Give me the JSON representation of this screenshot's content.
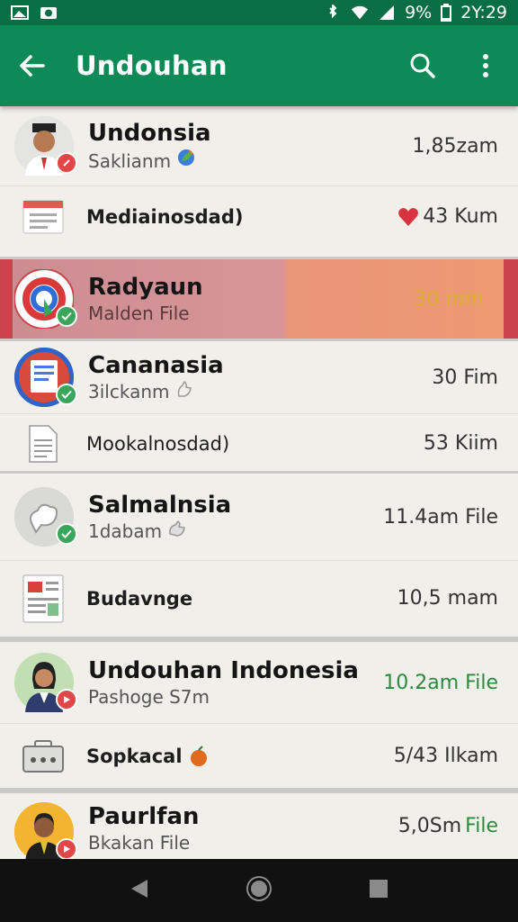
{
  "status_bar": {
    "battery": "9%",
    "time": "2Y:29"
  },
  "app_bar": {
    "title": "Undouhan"
  },
  "groups": [
    {
      "main": {
        "name": "Undonsia",
        "sub": "Saklianm",
        "meta": "1,85zam"
      },
      "sub": {
        "label": "Mediainosdad)",
        "meta": "43 Kum"
      }
    },
    {
      "main": {
        "name": "Radyaun",
        "sub": "Malden File",
        "meta": "30 mm"
      }
    },
    {
      "main": {
        "name": "Cananasia",
        "sub": "3ilckanm",
        "meta": "30 Fim"
      },
      "sub": {
        "label": "Mookalnosdad)",
        "meta": "53 Kiim"
      }
    },
    {
      "main": {
        "name": "Salmalnsia",
        "sub": "1dabam",
        "meta": "11.4am File"
      },
      "sub": {
        "label": "Budavnge",
        "meta": "10,5  mam"
      }
    },
    {
      "main": {
        "name": "Undouhan Indonesia",
        "sub": "Pashoge S7m",
        "meta": "10.2am File"
      },
      "sub": {
        "label": "Sopkacal",
        "meta": "5/43 Ilkam"
      }
    },
    {
      "main": {
        "name": "Paurlfan",
        "sub": "Bkakan File",
        "meta_num": "5,0Sm",
        "meta_word": "File"
      }
    }
  ],
  "colors": {
    "primary": "#0e8a57",
    "status_bar": "#0a6e45",
    "highlight_edge": "#c9444d",
    "highlight_left": "#d89599",
    "highlight_right": "#ed9a72",
    "green_text": "#2b8a3e"
  },
  "icons": [
    "back-arrow-icon",
    "search-icon",
    "overflow-menu-icon",
    "nav-back-icon",
    "nav-home-icon",
    "nav-recents-icon"
  ]
}
